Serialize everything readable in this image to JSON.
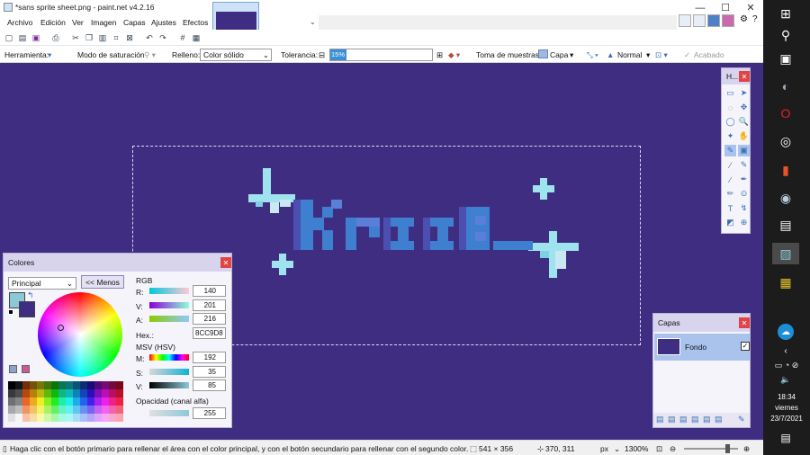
{
  "window": {
    "title": "*sans sprite sheet.png - paint.net v4.2.16",
    "minimize": "—",
    "maximize": "☐",
    "close": "✕"
  },
  "menu": [
    "Archivo",
    "Edición",
    "Ver",
    "Imagen",
    "Capas",
    "Ajustes",
    "Efectos"
  ],
  "toolbar_options": {
    "tool_label": "Herramienta:",
    "saturation_label": "Modo de saturación",
    "fill_label": "Relleno:",
    "fill_value": "Color sólido",
    "tolerance_label": "Tolerancia:",
    "tolerance_value": "15%",
    "sampling_label": "Toma de muestras:",
    "sampling_value": "Capa",
    "blend_value": "Normal",
    "finish_label": "Acabado"
  },
  "colors_panel": {
    "title": "Colores",
    "palette_select": "Principal",
    "less_button": "<< Menos",
    "rgb_label": "RGB",
    "r_label": "R:",
    "r_value": "140",
    "g_label": "V:",
    "g_value": "201",
    "a_label": "A:",
    "a_value": "216",
    "hex_label": "Hex.:",
    "hex_value": "8CC9D8",
    "hsv_label": "MSV (HSV)",
    "h_label": "M:",
    "h_value": "192",
    "s_label": "S:",
    "s_value": "35",
    "v_label": "V:",
    "v_value": "85",
    "opacity_label": "Opacidad (canal alfa)",
    "opacity_value": "255",
    "primary_color": "#8cc9d8",
    "secondary_color": "#3f2d82"
  },
  "tools_panel": {
    "title": "H..."
  },
  "layers_panel": {
    "title": "Capas",
    "layer_name": "Fondo"
  },
  "status": {
    "hint": "Haga clic con el botón primario para rellenar el área con el color principal, y con el botón secundario para rellenar con el segundo color.",
    "selection_size": "541 × 356",
    "cursor_pos": "370, 311",
    "unit": "px",
    "zoom": "1300%"
  },
  "taskbar": {
    "time": "18:34",
    "day": "viernes",
    "date": "23/7/2021"
  },
  "canvas_colors": {
    "background": "#3f2d82",
    "text": "#3f7fd0",
    "sparkle": "#9fe3ee"
  }
}
